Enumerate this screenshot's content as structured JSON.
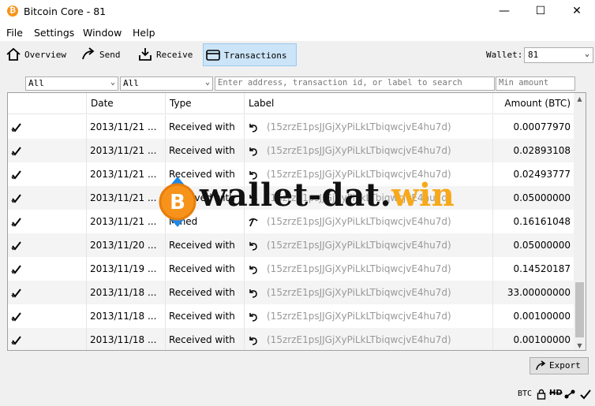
{
  "window": {
    "title": "Bitcoin Core - 81",
    "minimize": "—",
    "maximize": "☐",
    "close": "✕"
  },
  "menu": [
    "File",
    "Settings",
    "Window",
    "Help"
  ],
  "toolbar": {
    "overview": "Overview",
    "send": "Send",
    "receive": "Receive",
    "transactions": "Transactions",
    "wallet_label": "Wallet:",
    "wallet_value": "81"
  },
  "filters": {
    "date": "All",
    "type": "All",
    "search_placeholder": "Enter address, transaction id, or label to search",
    "min_amount_placeholder": "Min amount"
  },
  "table": {
    "headers": {
      "date": "Date",
      "type": "Type",
      "label": "Label",
      "amount": "Amount (BTC)"
    },
    "rows": [
      {
        "date": "2013/11/21 ...",
        "type": "Received with",
        "label": "(15zrzE1psJJGjXyPiLkLTbiqwcjvE4hu7d)",
        "amount": "0.00077970",
        "kind": "received"
      },
      {
        "date": "2013/11/21 ...",
        "type": "Received with",
        "label": "(15zrzE1psJJGjXyPiLkLTbiqwcjvE4hu7d)",
        "amount": "0.02893108",
        "kind": "received"
      },
      {
        "date": "2013/11/21 ...",
        "type": "Received with",
        "label": "(15zrzE1psJJGjXyPiLkLTbiqwcjvE4hu7d)",
        "amount": "0.02493777",
        "kind": "received"
      },
      {
        "date": "2013/11/21 ...",
        "type": "Received with",
        "label": "(15zrzE1psJJGjXyPiLkLTbiqwcjvE4hu7d)",
        "amount": "0.05000000",
        "kind": "received"
      },
      {
        "date": "2013/11/21 ...",
        "type": "Mined",
        "label": "(15zrzE1psJJGjXyPiLkLTbiqwcjvE4hu7d)",
        "amount": "0.16161048",
        "kind": "mined"
      },
      {
        "date": "2013/11/20 ...",
        "type": "Received with",
        "label": "(15zrzE1psJJGjXyPiLkLTbiqwcjvE4hu7d)",
        "amount": "0.05000000",
        "kind": "received"
      },
      {
        "date": "2013/11/19 ...",
        "type": "Received with",
        "label": "(15zrzE1psJJGjXyPiLkLTbiqwcjvE4hu7d)",
        "amount": "0.14520187",
        "kind": "received"
      },
      {
        "date": "2013/11/18 ...",
        "type": "Received with",
        "label": "(15zrzE1psJJGjXyPiLkLTbiqwcjvE4hu7d)",
        "amount": "33.00000000",
        "kind": "received"
      },
      {
        "date": "2013/11/18 ...",
        "type": "Received with",
        "label": "(15zrzE1psJJGjXyPiLkLTbiqwcjvE4hu7d)",
        "amount": "0.00100000",
        "kind": "received"
      },
      {
        "date": "2013/11/18 ...",
        "type": "Received with",
        "label": "(15zrzE1psJJGjXyPiLkLTbiqwcjvE4hu7d)",
        "amount": "0.00100000",
        "kind": "received"
      }
    ]
  },
  "export_label": "Export",
  "status": {
    "unit": "BTC",
    "hd": "HD"
  },
  "watermark": {
    "prefix": "wallet-dat.",
    "suffix": "win",
    "coin": "B"
  },
  "colors": {
    "accent": "#cce4f7",
    "bitcoin": "#f7931a",
    "watermark_accent": "#f7a81b"
  }
}
